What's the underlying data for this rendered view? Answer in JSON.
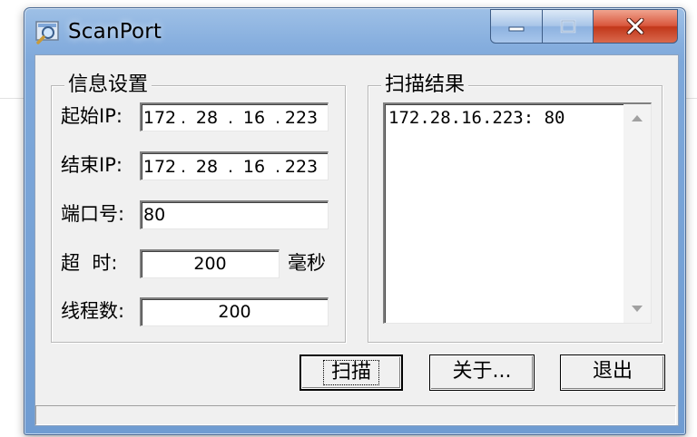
{
  "window": {
    "title": "ScanPort",
    "icon": "magnifier-icon",
    "controls": {
      "minimize": "minimize-icon",
      "maximize": "maximize-icon",
      "close": "close-icon"
    }
  },
  "settings": {
    "group_title": "信息设置",
    "start_ip": {
      "label": "起始IP:",
      "octets": [
        "172",
        "28",
        "16",
        "223"
      ]
    },
    "end_ip": {
      "label": "结束IP:",
      "octets": [
        "172",
        "28",
        "16",
        "223"
      ]
    },
    "port": {
      "label": "端口号:",
      "value": "80"
    },
    "timeout": {
      "label": "超  时:",
      "value": "200",
      "unit": "毫秒"
    },
    "threads": {
      "label": "线程数:",
      "value": "200"
    }
  },
  "results": {
    "group_title": "扫描结果",
    "lines": [
      "172.28.16.223: 80"
    ]
  },
  "buttons": {
    "scan": "扫描",
    "about": "关于...",
    "exit": "退出"
  }
}
